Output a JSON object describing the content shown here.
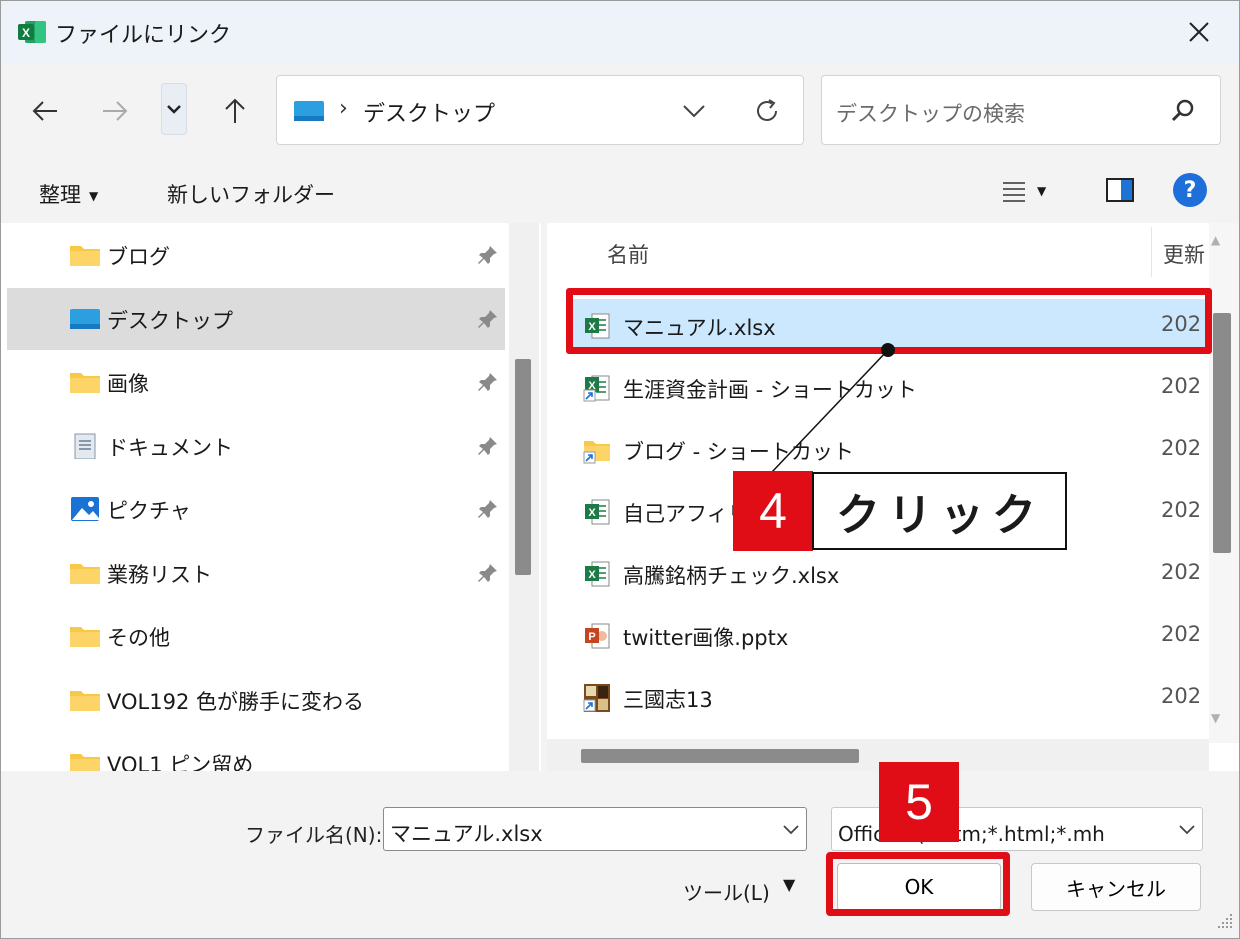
{
  "window": {
    "title": "ファイルにリンク"
  },
  "address": {
    "separator": "›",
    "location": "デスクトップ"
  },
  "search": {
    "placeholder": "デスクトップの検索"
  },
  "toolbar": {
    "organize": "整理",
    "new_folder": "新しいフォルダー",
    "help": "?"
  },
  "nav_items": [
    {
      "label": "ブログ",
      "icon": "folder-icon",
      "pinned": true
    },
    {
      "label": "デスクトップ",
      "icon": "desktop-folder-icon",
      "pinned": true,
      "selected": true
    },
    {
      "label": "画像",
      "icon": "folder-icon",
      "pinned": true
    },
    {
      "label": "ドキュメント",
      "icon": "documents-icon",
      "pinned": true
    },
    {
      "label": "ピクチャ",
      "icon": "pictures-icon",
      "pinned": true
    },
    {
      "label": "業務リスト",
      "icon": "folder-icon",
      "pinned": true
    },
    {
      "label": "その他",
      "icon": "folder-icon",
      "pinned": false
    },
    {
      "label": "VOL192 色が勝手に変わる",
      "icon": "folder-icon",
      "pinned": false
    },
    {
      "label": "VOL1 ピン留め",
      "icon": "folder-icon",
      "pinned": false
    }
  ],
  "columns": {
    "name": "名前",
    "date": "更新"
  },
  "files": [
    {
      "name": "マニュアル.xlsx",
      "date": "202",
      "icon": "excel-file-icon",
      "selected": true
    },
    {
      "name": "生涯資金計画 - ショートカット",
      "date": "202",
      "icon": "excel-shortcut-icon"
    },
    {
      "name": "ブログ - ショートカット",
      "date": "202",
      "icon": "folder-shortcut-icon"
    },
    {
      "name": "自己アフィリ",
      "date": "202",
      "icon": "excel-file-icon"
    },
    {
      "name": "高騰銘柄チェック.xlsx",
      "date": "202",
      "icon": "excel-file-icon"
    },
    {
      "name": "twitter画像.pptx",
      "date": "202",
      "icon": "powerpoint-file-icon"
    },
    {
      "name": "三國志13",
      "date": "202",
      "icon": "game-shortcut-icon"
    }
  ],
  "bottom": {
    "filename_label": "ファイル名(N):",
    "filename_value": "マニュアル.xlsx",
    "filetype_value": "Offic    ル (*.htm;*.html;*.mh",
    "tools_label": "ツール(L)",
    "ok_label": "OK",
    "cancel_label": "キャンセル"
  },
  "annotations": {
    "step4_number": "4",
    "step4_text": "クリック",
    "step5_number": "5"
  },
  "colors": {
    "highlight_red": "#e00d16",
    "selection_blue": "#cce8ff",
    "excel_green": "#1d7a45"
  }
}
